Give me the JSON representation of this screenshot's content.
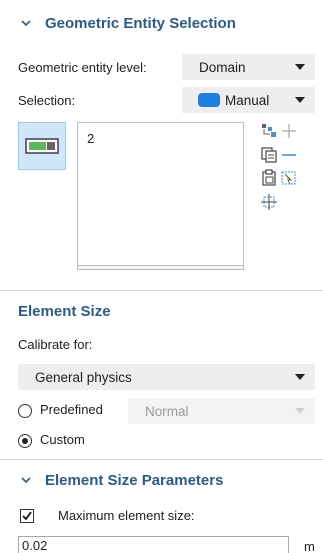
{
  "geometric_entity_selection": {
    "title": "Geometric Entity Selection",
    "entity_level_label": "Geometric entity level:",
    "entity_level_value": "Domain",
    "selection_label": "Selection:",
    "selection_value": "Manual",
    "selection_color": "#1f7fe0",
    "selected_items": [
      "2"
    ],
    "tools": [
      "paste-selection-icon",
      "copy-selection-icon",
      "clear-selection-icon",
      "zoom-to-selection-icon",
      "add-to-selection-icon",
      "remove-from-selection-icon",
      "activate-selection-icon"
    ]
  },
  "element_size": {
    "title": "Element Size",
    "calibrate_label": "Calibrate for:",
    "calibrate_value": "General physics",
    "predefined_label": "Predefined",
    "predefined_value": "Normal",
    "custom_label": "Custom",
    "selected_mode": "custom"
  },
  "element_size_parameters": {
    "title": "Element Size Parameters",
    "max_size_label": "Maximum element size:",
    "max_size_checked": true,
    "max_size_value": "0.02",
    "max_size_unit": "m"
  },
  "colors": {
    "section_title": "#2c5a8a",
    "toggle_background": "#cfe6fb",
    "toggle_green": "#5cb85c"
  }
}
